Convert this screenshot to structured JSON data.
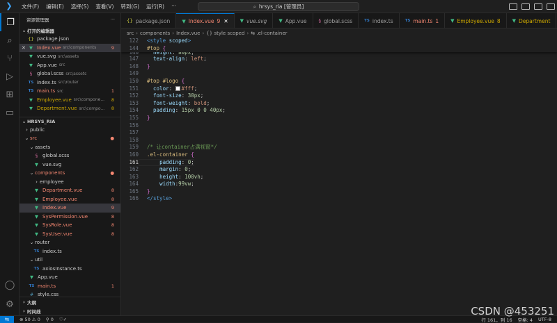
{
  "titlebar": {
    "menu": [
      "文件(F)",
      "编辑(E)",
      "选择(S)",
      "查看(V)",
      "转到(G)",
      "运行(R)",
      "···"
    ],
    "search_text": "hrsys_ria [管理员]"
  },
  "sidebar": {
    "title": "资源管理器",
    "more": "···",
    "open_editors_label": "打开的编辑器",
    "open_editors": [
      {
        "icon": "{}",
        "name": "package.json",
        "path": "",
        "badge": "",
        "status": "normal"
      },
      {
        "icon": "▼",
        "name": "Index.vue",
        "path": "src\\components",
        "badge": "9",
        "status": "error",
        "close": "✕"
      },
      {
        "icon": "▼",
        "name": "vue.svg",
        "path": "src\\assets",
        "badge": "",
        "status": "normal"
      },
      {
        "icon": "▼",
        "name": "App.vue",
        "path": "src",
        "badge": "",
        "status": "normal"
      },
      {
        "icon": "§",
        "name": "global.scss",
        "path": "src\\assets",
        "badge": "",
        "status": "normal"
      },
      {
        "icon": "TS",
        "name": "index.ts",
        "path": "src\\router",
        "badge": "",
        "status": "normal"
      },
      {
        "icon": "TS",
        "name": "main.ts",
        "path": "src",
        "badge": "1",
        "status": "error"
      },
      {
        "icon": "▼",
        "name": "Employee.vue",
        "path": "src\\compone...",
        "badge": "8",
        "status": "warn"
      },
      {
        "icon": "▼",
        "name": "Department.vue",
        "path": "src\\compo...",
        "badge": "8",
        "status": "warn"
      }
    ],
    "project_label": "HRSYS_RIA",
    "tree": [
      {
        "indent": 0,
        "arrow": "›",
        "name": "public",
        "badge": "",
        "status": "normal"
      },
      {
        "indent": 0,
        "arrow": "⌄",
        "name": "src",
        "badge": "●",
        "status": "error"
      },
      {
        "indent": 1,
        "arrow": "⌄",
        "name": "assets",
        "badge": "",
        "status": "normal"
      },
      {
        "indent": 2,
        "icon": "§",
        "name": "global.scss",
        "badge": "",
        "status": "normal"
      },
      {
        "indent": 2,
        "icon": "▼",
        "name": "vue.svg",
        "badge": "",
        "status": "normal"
      },
      {
        "indent": 1,
        "arrow": "⌄",
        "name": "components",
        "badge": "●",
        "status": "error"
      },
      {
        "indent": 2,
        "arrow": "›",
        "name": "employee",
        "badge": "",
        "status": "normal"
      },
      {
        "indent": 2,
        "icon": "▼",
        "name": "Department.vue",
        "badge": "8",
        "status": "error"
      },
      {
        "indent": 2,
        "icon": "▼",
        "name": "Employee.vue",
        "badge": "8",
        "status": "error"
      },
      {
        "indent": 2,
        "icon": "▼",
        "name": "Index.vue",
        "badge": "9",
        "status": "error",
        "selected": true
      },
      {
        "indent": 2,
        "icon": "▼",
        "name": "SysPermission.vue",
        "badge": "8",
        "status": "error"
      },
      {
        "indent": 2,
        "icon": "▼",
        "name": "SysRole.vue",
        "badge": "8",
        "status": "error"
      },
      {
        "indent": 2,
        "icon": "▼",
        "name": "SysUser.vue",
        "badge": "8",
        "status": "error"
      },
      {
        "indent": 1,
        "arrow": "⌄",
        "name": "router",
        "badge": "",
        "status": "normal"
      },
      {
        "indent": 2,
        "icon": "TS",
        "name": "index.ts",
        "badge": "",
        "status": "normal"
      },
      {
        "indent": 1,
        "arrow": "⌄",
        "name": "util",
        "badge": "",
        "status": "normal"
      },
      {
        "indent": 2,
        "icon": "TS",
        "name": "axiosInstance.ts",
        "badge": "",
        "status": "normal"
      },
      {
        "indent": 1,
        "icon": "▼",
        "name": "App.vue",
        "badge": "",
        "status": "normal"
      },
      {
        "indent": 1,
        "icon": "TS",
        "name": "main.ts",
        "badge": "1",
        "status": "error"
      },
      {
        "indent": 1,
        "icon": "#",
        "name": "style.css",
        "badge": "",
        "status": "normal"
      }
    ],
    "outline_label": "大纲",
    "timeline_label": "时间线"
  },
  "tabs": [
    {
      "icon": "{}",
      "label": "package.json",
      "badge": "",
      "status": "normal"
    },
    {
      "icon": "▼",
      "label": "Index.vue",
      "badge": "9",
      "status": "error",
      "active": true,
      "close": "✕"
    },
    {
      "icon": "▼",
      "label": "vue.svg",
      "badge": "",
      "status": "italic"
    },
    {
      "icon": "▼",
      "label": "App.vue",
      "badge": "",
      "status": "normal"
    },
    {
      "icon": "§",
      "label": "global.scss",
      "badge": "",
      "status": "normal"
    },
    {
      "icon": "TS",
      "label": "index.ts",
      "badge": "",
      "status": "normal"
    },
    {
      "icon": "TS",
      "label": "main.ts",
      "badge": "1",
      "status": "error"
    },
    {
      "icon": "▼",
      "label": "Employee.vue",
      "badge": "8",
      "status": "warn"
    },
    {
      "icon": "▼",
      "label": "Department",
      "badge": "",
      "status": "warn"
    }
  ],
  "breadcrumb": [
    "src",
    "components",
    "Index.vue",
    "{} style scoped",
    "⇆ .el-container"
  ],
  "editor": {
    "sticky": [
      {
        "n": "122",
        "segs": [
          [
            "<",
            "t-tag"
          ],
          [
            "style ",
            "t-tag"
          ],
          [
            "scoped",
            "t-attr"
          ],
          [
            ">",
            "t-tag"
          ]
        ]
      },
      {
        "n": "144",
        "segs": [
          [
            "#top ",
            "t-sel"
          ],
          [
            "{",
            "t-brace"
          ]
        ]
      }
    ],
    "lines": [
      {
        "n": "146",
        "segs": [
          [
            "  ",
            ""
          ],
          [
            "height",
            "t-prop"
          ],
          [
            ": ",
            ""
          ],
          [
            "80px",
            "t-num"
          ],
          [
            ";",
            ""
          ]
        ],
        "partial": true
      },
      {
        "n": "147",
        "segs": [
          [
            "  ",
            ""
          ],
          [
            "text-align",
            "t-prop"
          ],
          [
            ": ",
            ""
          ],
          [
            "left",
            "t-val"
          ],
          [
            ";",
            ""
          ]
        ]
      },
      {
        "n": "148",
        "segs": [
          [
            "}",
            "t-brace"
          ]
        ]
      },
      {
        "n": "149",
        "segs": []
      },
      {
        "n": "150",
        "segs": [
          [
            "#top #logo ",
            "t-sel"
          ],
          [
            "{",
            "t-brace"
          ]
        ]
      },
      {
        "n": "151",
        "segs": [
          [
            "  ",
            ""
          ],
          [
            "color",
            "t-prop"
          ],
          [
            ": ",
            ""
          ],
          [
            "SWATCH",
            ""
          ],
          [
            "#fff",
            "t-val"
          ],
          [
            ";",
            ""
          ]
        ]
      },
      {
        "n": "152",
        "segs": [
          [
            "  ",
            ""
          ],
          [
            "font-size",
            "t-prop"
          ],
          [
            ": ",
            ""
          ],
          [
            "30px",
            "t-num"
          ],
          [
            ";",
            ""
          ]
        ]
      },
      {
        "n": "153",
        "segs": [
          [
            "  ",
            ""
          ],
          [
            "font-weight",
            "t-prop"
          ],
          [
            ": ",
            ""
          ],
          [
            "bold",
            "t-val"
          ],
          [
            ";",
            ""
          ]
        ]
      },
      {
        "n": "154",
        "segs": [
          [
            "  ",
            ""
          ],
          [
            "padding",
            "t-prop"
          ],
          [
            ": ",
            ""
          ],
          [
            "15px 0 0 40px",
            "t-num"
          ],
          [
            ";",
            ""
          ]
        ]
      },
      {
        "n": "155",
        "segs": [
          [
            "}",
            "t-brace"
          ]
        ]
      },
      {
        "n": "156",
        "segs": []
      },
      {
        "n": "157",
        "segs": []
      },
      {
        "n": "158",
        "segs": []
      },
      {
        "n": "159",
        "segs": [
          [
            "/* 让container占满视窗*/",
            "t-com"
          ]
        ]
      },
      {
        "n": "160",
        "segs": [
          [
            ".el-container ",
            "t-sel"
          ],
          [
            "{",
            "t-brace"
          ]
        ]
      },
      {
        "n": "161",
        "segs": [
          [
            "    ",
            ""
          ],
          [
            "padding",
            "t-prop"
          ],
          [
            ": ",
            ""
          ],
          [
            "0",
            "t-num"
          ],
          [
            ";",
            ""
          ]
        ],
        "current": true
      },
      {
        "n": "162",
        "segs": [
          [
            "    ",
            ""
          ],
          [
            "margin",
            "t-prop"
          ],
          [
            ": ",
            ""
          ],
          [
            "0",
            "t-num"
          ],
          [
            ";",
            ""
          ]
        ]
      },
      {
        "n": "163",
        "segs": [
          [
            "    ",
            ""
          ],
          [
            "height",
            "t-prop"
          ],
          [
            ": ",
            ""
          ],
          [
            "100vh",
            "t-num"
          ],
          [
            ";",
            ""
          ]
        ]
      },
      {
        "n": "164",
        "segs": [
          [
            "    ",
            ""
          ],
          [
            "width",
            "t-prop"
          ],
          [
            ":",
            ""
          ],
          [
            "99vw",
            "t-num"
          ],
          [
            ";",
            ""
          ]
        ]
      },
      {
        "n": "165",
        "segs": [
          [
            "}",
            "t-brace"
          ]
        ]
      },
      {
        "n": "166",
        "segs": [
          [
            "</",
            "t-tag"
          ],
          [
            "style",
            "t-tag"
          ],
          [
            ">",
            "t-tag"
          ]
        ]
      }
    ]
  },
  "statusbar": {
    "remote": "⇆",
    "problems": "⊗ 50 ⚠ 0",
    "ports": "⚲ 0",
    "sync": "♡✓",
    "position": "行 161，列 16",
    "spaces": "空格: 4",
    "encoding": "UTF-8"
  },
  "watermark": "CSDN @453251",
  "colors": {
    "accent": "#0078d4",
    "error": "#f48771",
    "warn": "#cca700",
    "vue": "#41b883"
  }
}
